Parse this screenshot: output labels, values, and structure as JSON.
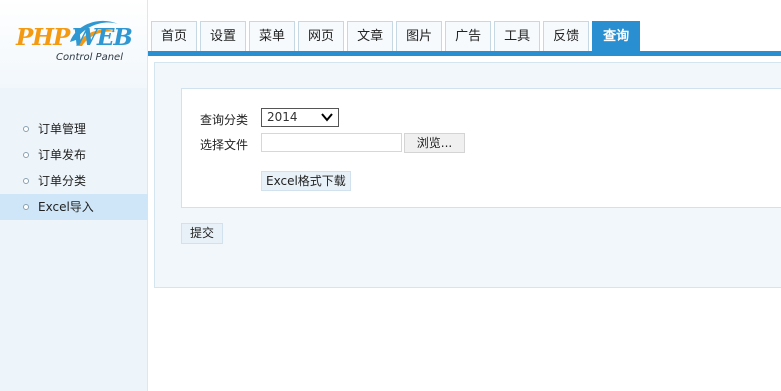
{
  "logo": {
    "php": "PHP",
    "web": "WEB",
    "subtitle": "Control Panel"
  },
  "nav": {
    "tabs": [
      {
        "label": "首页"
      },
      {
        "label": "设置"
      },
      {
        "label": "菜单"
      },
      {
        "label": "网页"
      },
      {
        "label": "文章"
      },
      {
        "label": "图片"
      },
      {
        "label": "广告"
      },
      {
        "label": "工具"
      },
      {
        "label": "反馈"
      },
      {
        "label": "查询"
      }
    ],
    "active_index": 9
  },
  "sidebar": {
    "items": [
      {
        "label": "订单管理"
      },
      {
        "label": "订单发布"
      },
      {
        "label": "订单分类"
      },
      {
        "label": "Excel导入"
      }
    ],
    "active_index": 3
  },
  "form": {
    "query_category_label": "查询分类",
    "query_category_value": "2014",
    "select_file_label": "选择文件",
    "file_value": "",
    "browse_label": "浏览...",
    "excel_download_label": "Excel格式下载",
    "submit_label": "提交"
  },
  "colors": {
    "accent": "#2a8fd0",
    "logo_orange": "#f39a12",
    "logo_blue": "#2f98d3",
    "sidebar_bg": "#eef5fa",
    "sidebar_active": "#cfe6f8"
  },
  "icons": {
    "select_arrow": "chevron-down-icon",
    "menu_bullet": "circle-bullet-icon"
  }
}
